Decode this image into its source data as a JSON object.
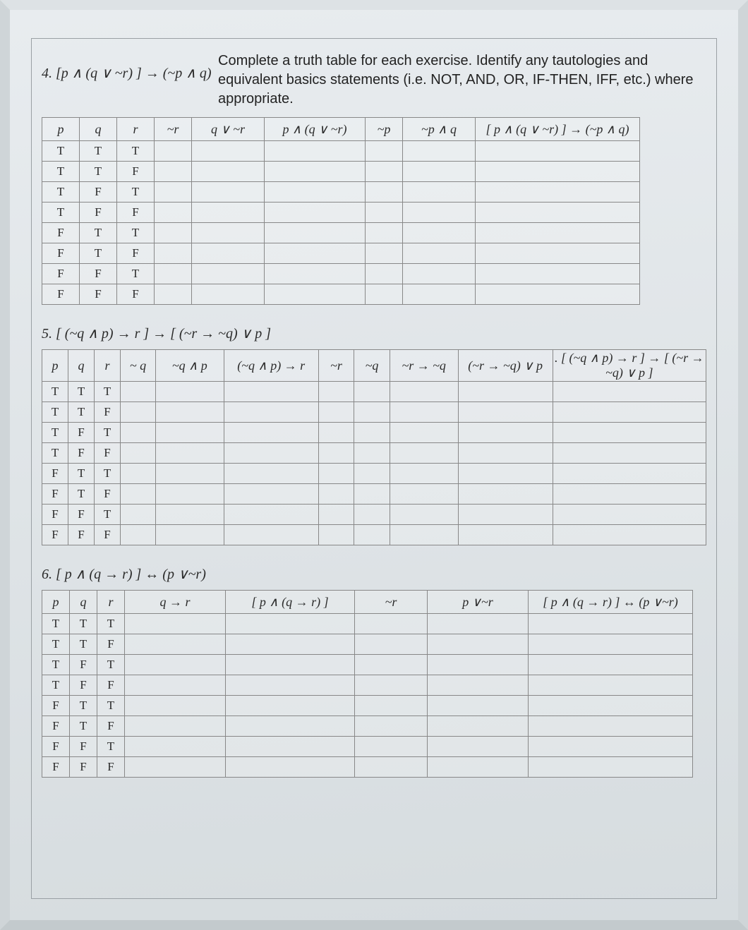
{
  "instructions": "Complete a truth table for each exercise. Identify any tautologies and equivalent basics statements (i.e. NOT, AND, OR, IF-THEN, IFF, etc.) where appropriate.",
  "problems": {
    "p4": {
      "label": "4. [p ∧ (q ∨ ~r) ] → (~p ∧ q)",
      "headers": [
        "p",
        "q",
        "r",
        "~r",
        "q ∨ ~r",
        "p ∧ (q ∨ ~r)",
        "~p",
        "~p ∧ q",
        "[ p ∧ (q ∨ ~r) ] → (~p ∧ q)"
      ],
      "rows": [
        [
          "T",
          "T",
          "T",
          "",
          "",
          "",
          "",
          "",
          ""
        ],
        [
          "T",
          "T",
          "F",
          "",
          "",
          "",
          "",
          "",
          ""
        ],
        [
          "T",
          "F",
          "T",
          "",
          "",
          "",
          "",
          "",
          ""
        ],
        [
          "T",
          "F",
          "F",
          "",
          "",
          "",
          "",
          "",
          ""
        ],
        [
          "F",
          "T",
          "T",
          "",
          "",
          "",
          "",
          "",
          ""
        ],
        [
          "F",
          "T",
          "F",
          "",
          "",
          "",
          "",
          "",
          ""
        ],
        [
          "F",
          "F",
          "T",
          "",
          "",
          "",
          "",
          "",
          ""
        ],
        [
          "F",
          "F",
          "F",
          "",
          "",
          "",
          "",
          "",
          ""
        ]
      ],
      "col_classes": [
        "w-sm",
        "w-sm",
        "w-sm",
        "w-sm",
        "w-med",
        "w-lg",
        "w-sm",
        "w-med",
        "w-xxl"
      ]
    },
    "p5": {
      "label": "5. [ (~q ∧ p) → r ] → [ (~r → ~q) ∨ p ]",
      "headers": [
        "p",
        "q",
        "r",
        "~ q",
        "~q ∧ p",
        "(~q ∧ p) → r",
        "~r",
        "~q",
        "~r → ~q",
        "(~r → ~q) ∨ p",
        ". [ (~q ∧ p) → r ] → [ (~r → ~q) ∨ p ]"
      ],
      "rows": [
        [
          "T",
          "T",
          "T",
          "",
          "",
          "",
          "",
          "",
          "",
          "",
          ""
        ],
        [
          "T",
          "T",
          "F",
          "",
          "",
          "",
          "",
          "",
          "",
          "",
          ""
        ],
        [
          "T",
          "F",
          "T",
          "",
          "",
          "",
          "",
          "",
          "",
          "",
          ""
        ],
        [
          "T",
          "F",
          "F",
          "",
          "",
          "",
          "",
          "",
          "",
          "",
          ""
        ],
        [
          "F",
          "T",
          "T",
          "",
          "",
          "",
          "",
          "",
          "",
          "",
          ""
        ],
        [
          "F",
          "T",
          "F",
          "",
          "",
          "",
          "",
          "",
          "",
          "",
          ""
        ],
        [
          "F",
          "F",
          "T",
          "",
          "",
          "",
          "",
          "",
          "",
          "",
          ""
        ],
        [
          "F",
          "F",
          "F",
          "",
          "",
          "",
          "",
          "",
          "",
          "",
          ""
        ]
      ],
      "col_classes": [
        "w-narrow",
        "w-narrow",
        "w-narrow",
        "w-sm",
        "w-med",
        "w-lg",
        "w-sm",
        "w-sm",
        "w-med",
        "w-lg",
        "w-xxl"
      ]
    },
    "p6": {
      "label": "6. [ p ∧ (q → r) ] ↔ (p ∨~r)",
      "headers": [
        "p",
        "q",
        "r",
        "q → r",
        "[ p ∧ (q → r) ]",
        "~r",
        "p ∨~r",
        "[ p ∧ (q → r) ] ↔ (p ∨~r)"
      ],
      "rows": [
        [
          "T",
          "T",
          "T",
          "",
          "",
          "",
          "",
          ""
        ],
        [
          "T",
          "T",
          "F",
          "",
          "",
          "",
          "",
          ""
        ],
        [
          "T",
          "F",
          "T",
          "",
          "",
          "",
          "",
          ""
        ],
        [
          "T",
          "F",
          "F",
          "",
          "",
          "",
          "",
          ""
        ],
        [
          "F",
          "T",
          "T",
          "",
          "",
          "",
          "",
          ""
        ],
        [
          "F",
          "T",
          "F",
          "",
          "",
          "",
          "",
          ""
        ],
        [
          "F",
          "F",
          "T",
          "",
          "",
          "",
          "",
          ""
        ],
        [
          "F",
          "F",
          "F",
          "",
          "",
          "",
          "",
          ""
        ]
      ],
      "col_classes": [
        "w-narrow",
        "w-narrow",
        "w-narrow",
        "w-lg",
        "w-xl",
        "w-med",
        "w-lg",
        "w-xxl"
      ]
    }
  }
}
